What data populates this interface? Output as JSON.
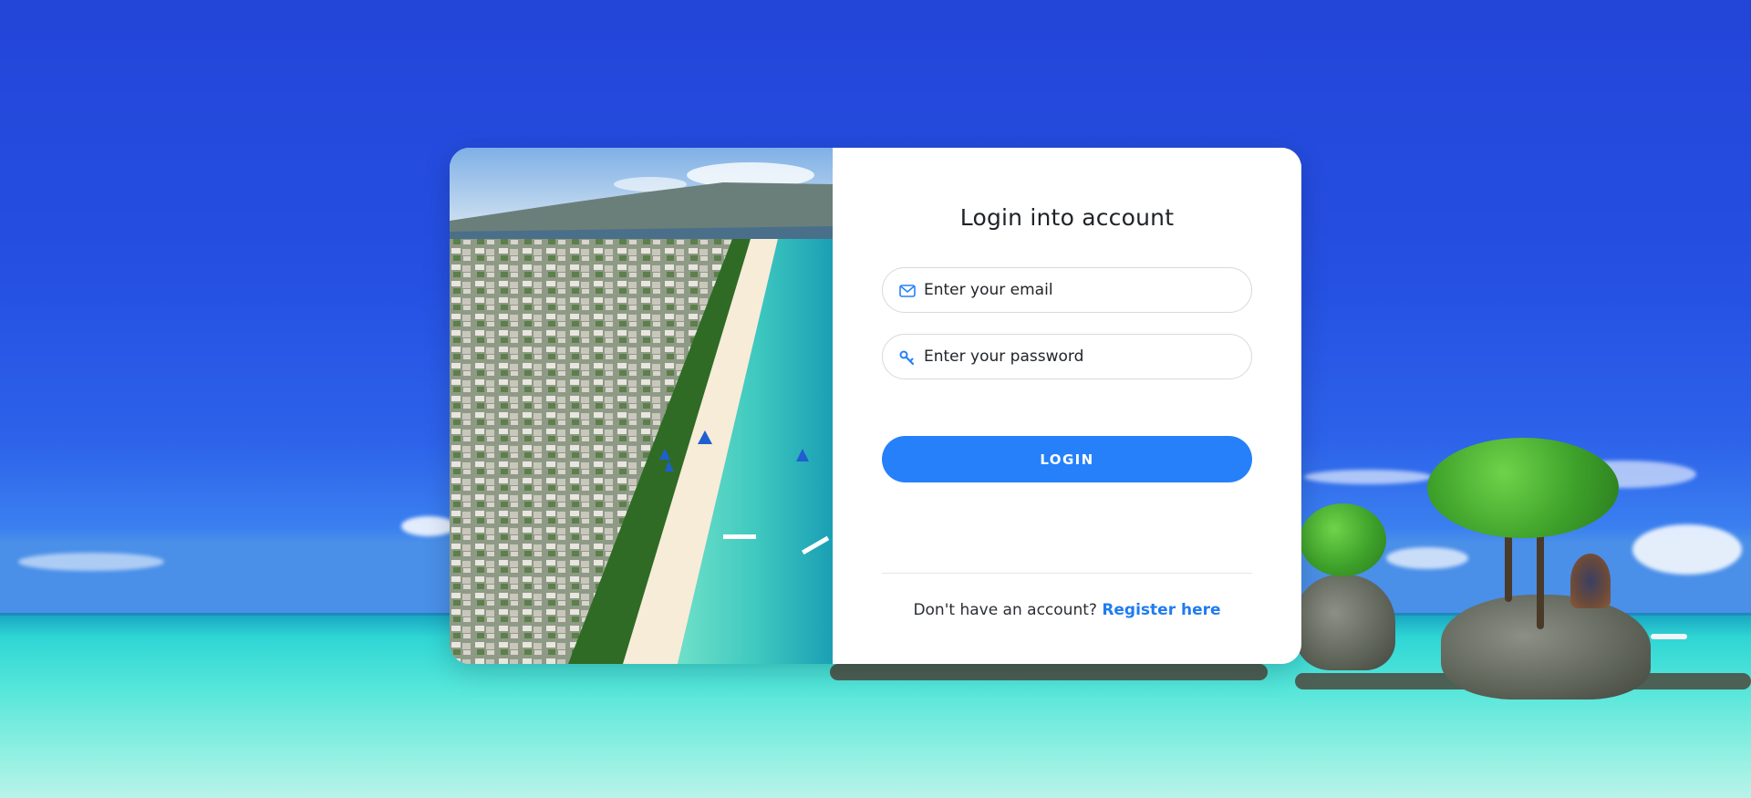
{
  "login": {
    "title": "Login into account",
    "email_placeholder": "Enter your email",
    "password_placeholder": "Enter your password",
    "login_label": "LOGIN",
    "register_prompt": "Don't have an account?",
    "register_link": "Register here"
  },
  "icons": {
    "email": "envelope-icon",
    "password": "key-icon"
  },
  "colors": {
    "accent": "#2680fa",
    "link": "#1f7cf0",
    "icon": "#2680fa",
    "card_background": "#ffffff",
    "sky": "#2345d8",
    "sea": "#2fd6d5"
  }
}
